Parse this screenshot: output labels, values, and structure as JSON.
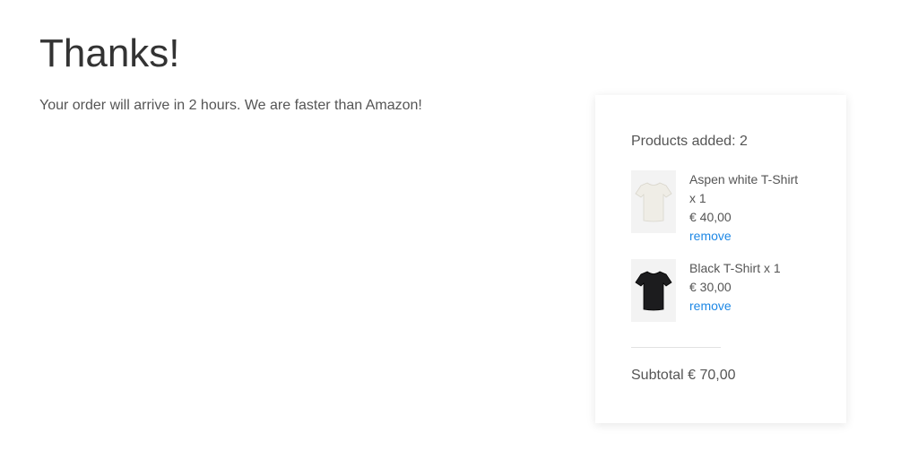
{
  "page": {
    "title": "Thanks!",
    "message": "Your order will arrive in 2 hours. We are faster than Amazon!"
  },
  "cart": {
    "products_added": "Products added: 2",
    "items": [
      {
        "name": "Aspen white T-Shirt x 1",
        "price": "€ 40,00",
        "remove_label": "remove",
        "image_icon": "white-tshirt-icon",
        "shirt_color": "#efede6"
      },
      {
        "name": "Black T-Shirt x 1",
        "price": "€ 30,00",
        "remove_label": "remove",
        "image_icon": "black-tshirt-icon",
        "shirt_color": "#1c1c1e"
      }
    ],
    "subtotal": "Subtotal € 70,00"
  },
  "colors": {
    "link": "#1e88e5",
    "text": "#555555",
    "heading": "#333333"
  }
}
